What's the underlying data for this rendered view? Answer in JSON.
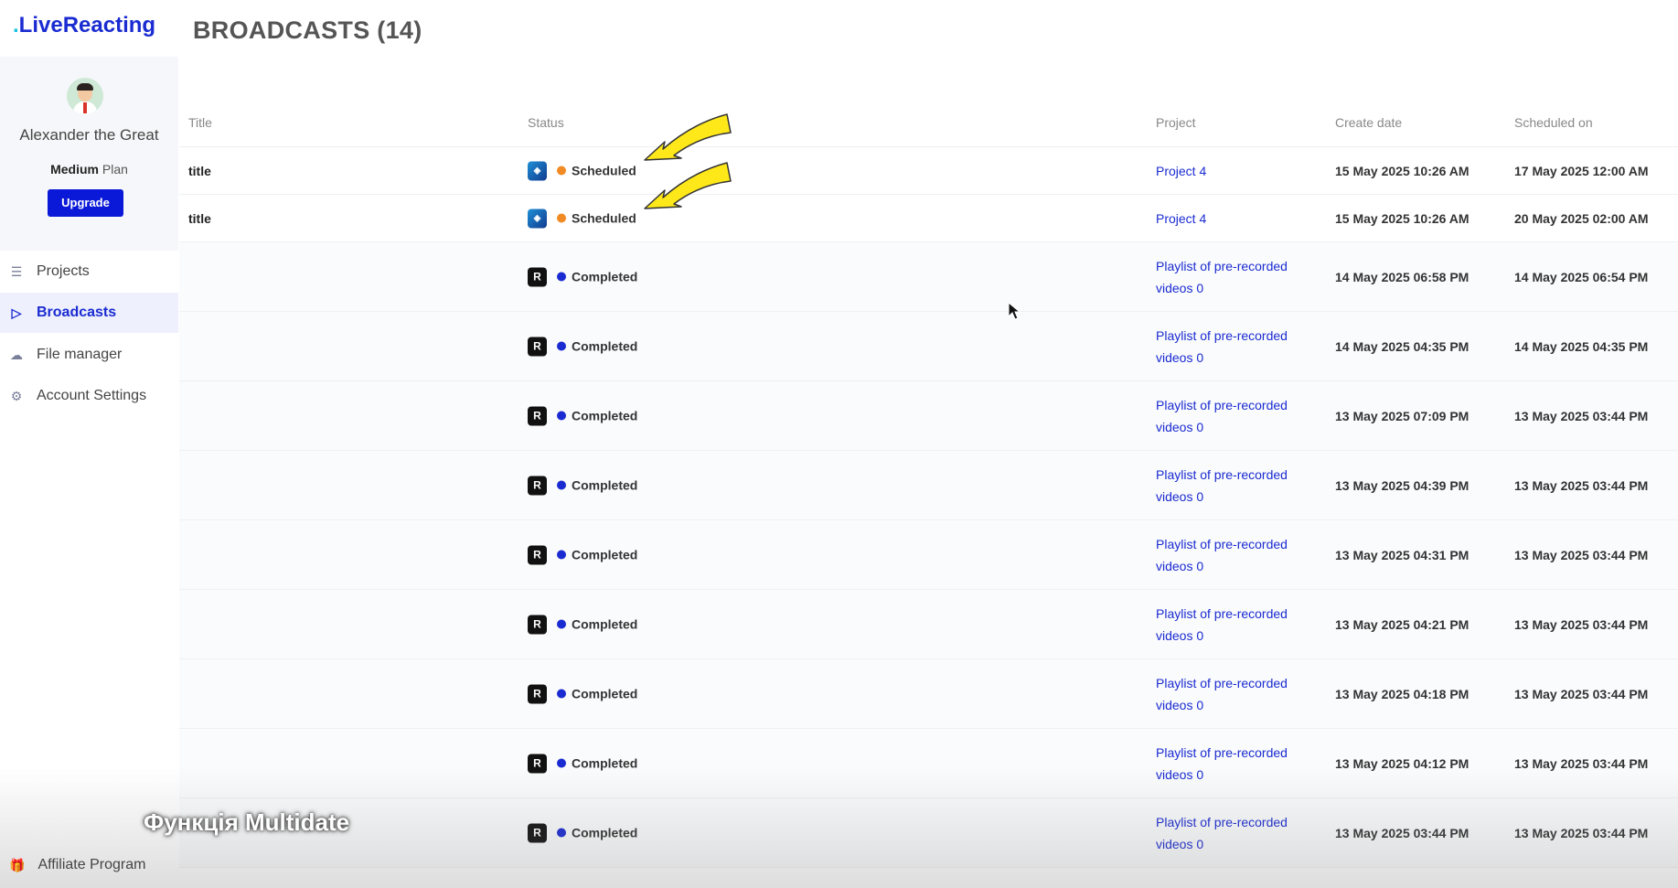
{
  "app": {
    "logo_dot": ".",
    "logo_text": "LiveReacting"
  },
  "profile": {
    "name": "Alexander the Great",
    "plan_bold": "Medium",
    "plan_suffix": " Plan",
    "upgrade_label": "Upgrade"
  },
  "nav": {
    "projects": "Projects",
    "broadcasts": "Broadcasts",
    "file_manager": "File manager",
    "account_settings": "Account Settings",
    "affiliate": "Affiliate Program"
  },
  "page": {
    "title": "BROADCASTS (14)"
  },
  "table": {
    "headers": {
      "title": "Title",
      "status": "Status",
      "project": "Project",
      "create_date": "Create date",
      "scheduled_on": "Scheduled on"
    },
    "rows": [
      {
        "title": "title",
        "platform": "youtube-thumbnail-icon",
        "status": "Scheduled",
        "status_color": "#f08a24",
        "project": "Project 4",
        "create": "15 May 2025 10:26 AM",
        "scheduled": "17 May 2025 12:00 AM"
      },
      {
        "title": "title",
        "platform": "youtube-thumbnail-icon",
        "status": "Scheduled",
        "status_color": "#f08a24",
        "project": "Project 4",
        "create": "15 May 2025 10:26 AM",
        "scheduled": "20 May 2025 02:00 AM"
      },
      {
        "title": "",
        "platform": "R",
        "status": "Completed",
        "status_color": "#1a2bd1",
        "project": "Playlist of pre-recorded videos 0",
        "create": "14 May 2025 06:58 PM",
        "scheduled": "14 May 2025 06:54 PM"
      },
      {
        "title": "",
        "platform": "R",
        "status": "Completed",
        "status_color": "#1a2bd1",
        "project": "Playlist of pre-recorded videos 0",
        "create": "14 May 2025 04:35 PM",
        "scheduled": "14 May 2025 04:35 PM"
      },
      {
        "title": "",
        "platform": "R",
        "status": "Completed",
        "status_color": "#1a2bd1",
        "project": "Playlist of pre-recorded videos 0",
        "create": "13 May 2025 07:09 PM",
        "scheduled": "13 May 2025 03:44 PM"
      },
      {
        "title": "",
        "platform": "R",
        "status": "Completed",
        "status_color": "#1a2bd1",
        "project": "Playlist of pre-recorded videos 0",
        "create": "13 May 2025 04:39 PM",
        "scheduled": "13 May 2025 03:44 PM"
      },
      {
        "title": "",
        "platform": "R",
        "status": "Completed",
        "status_color": "#1a2bd1",
        "project": "Playlist of pre-recorded videos 0",
        "create": "13 May 2025 04:31 PM",
        "scheduled": "13 May 2025 03:44 PM"
      },
      {
        "title": "",
        "platform": "R",
        "status": "Completed",
        "status_color": "#1a2bd1",
        "project": "Playlist of pre-recorded videos 0",
        "create": "13 May 2025 04:21 PM",
        "scheduled": "13 May 2025 03:44 PM"
      },
      {
        "title": "",
        "platform": "R",
        "status": "Completed",
        "status_color": "#1a2bd1",
        "project": "Playlist of pre-recorded videos 0",
        "create": "13 May 2025 04:18 PM",
        "scheduled": "13 May 2025 03:44 PM"
      },
      {
        "title": "",
        "platform": "R",
        "status": "Completed",
        "status_color": "#1a2bd1",
        "project": "Playlist of pre-recorded videos 0",
        "create": "13 May 2025 04:12 PM",
        "scheduled": "13 May 2025 03:44 PM"
      },
      {
        "title": "",
        "platform": "R",
        "status": "Completed",
        "status_color": "#1a2bd1",
        "project": "Playlist of pre-recorded videos 0",
        "create": "13 May 2025 03:44 PM",
        "scheduled": "13 May 2025 03:44 PM"
      }
    ]
  },
  "overlay": {
    "caption": "Функція Multidate"
  },
  "colors": {
    "accent": "#1a2bd1",
    "scheduled": "#f08a24",
    "completed": "#1a2bd1",
    "arrow": "#ffe81a"
  }
}
